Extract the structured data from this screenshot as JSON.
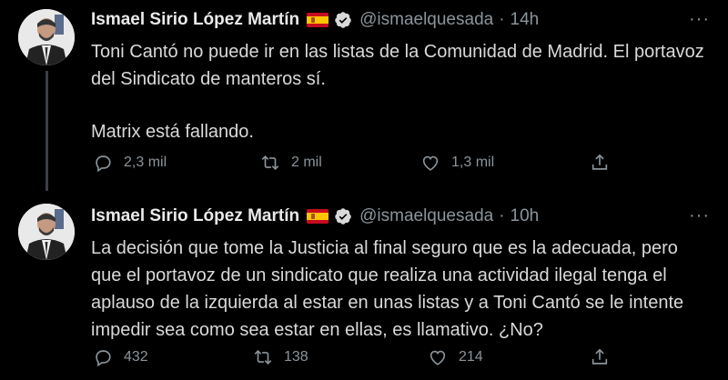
{
  "tweets": [
    {
      "author": {
        "name": "Ismael Sirio López Martín",
        "handle": "@ismaelquesada",
        "flag_icon": "spain-flag-icon",
        "verified_icon": "verified-badge-icon"
      },
      "separator": "·",
      "time": "14h",
      "more_label": "···",
      "text": [
        "Toni Cantó no puede ir en las listas de la Comunidad de Madrid. El portavoz del Sindicato de manteros sí.",
        "Matrix está fallando."
      ],
      "actions": {
        "replies": "2,3 mil",
        "retweets": "2 mil",
        "likes": "1,3 mil"
      }
    },
    {
      "author": {
        "name": "Ismael Sirio López Martín",
        "handle": "@ismaelquesada",
        "flag_icon": "spain-flag-icon",
        "verified_icon": "verified-badge-icon"
      },
      "separator": "·",
      "time": "10h",
      "more_label": "···",
      "text": [
        "La decisión que tome la Justicia al final seguro que es la adecuada, pero que el portavoz de un sindicato que realiza una actividad ilegal tenga el aplauso de la izquierda al estar en unas listas y a Toni Cantó se le intente impedir sea como sea estar en ellas, es llamativo. ¿No?"
      ],
      "actions": {
        "replies": "432",
        "retweets": "138",
        "likes": "214"
      }
    }
  ],
  "colors": {
    "background": "#000000",
    "text": "#d9d9d9",
    "muted": "#8b949b",
    "verified": "#d9d9d9",
    "thread_line": "#3a3f44"
  }
}
